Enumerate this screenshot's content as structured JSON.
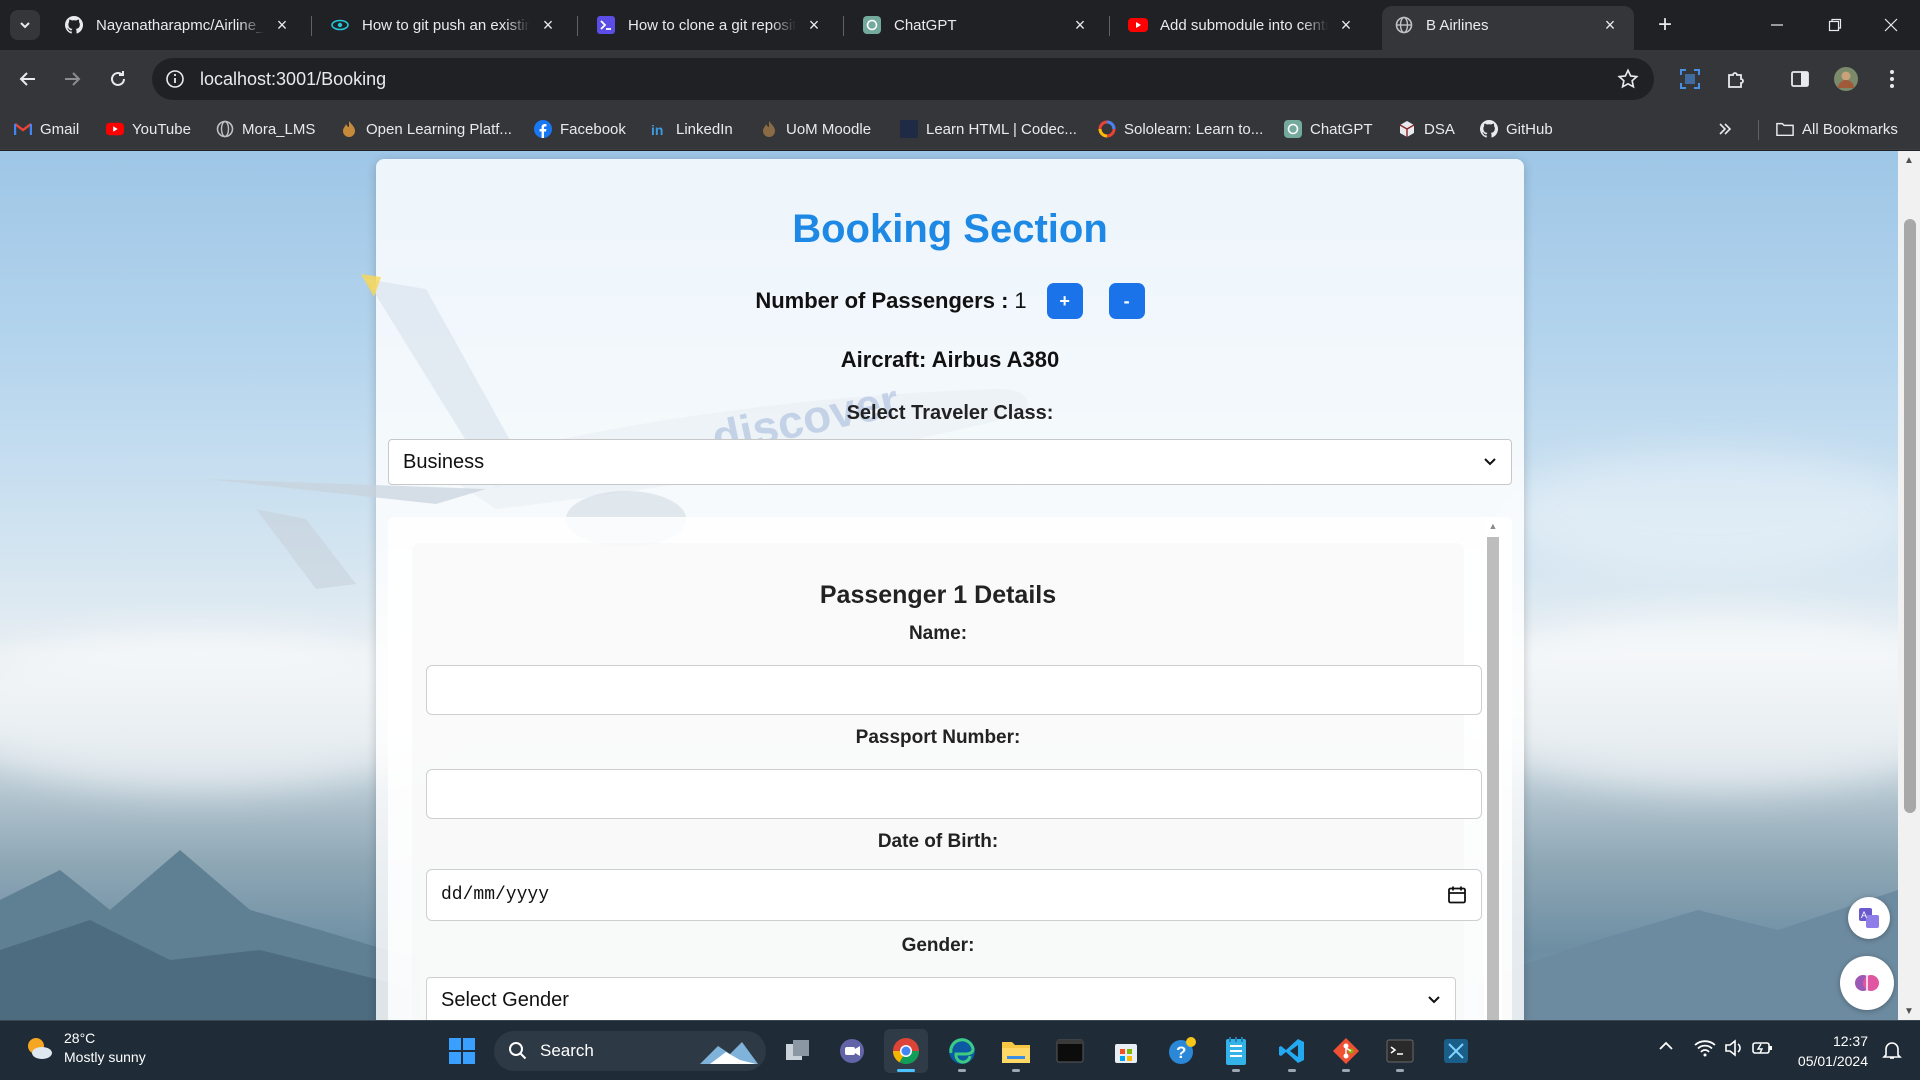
{
  "browser": {
    "tabs": [
      {
        "title": "Nayanatharapmc/Airline_R",
        "favicon": "github-icon"
      },
      {
        "title": "How to git push an existing",
        "favicon": "eye-icon"
      },
      {
        "title": "How to clone a git reposito",
        "favicon": "terminal-icon"
      },
      {
        "title": "ChatGPT",
        "favicon": "chatgpt-icon"
      },
      {
        "title": "Add submodule into centr",
        "favicon": "youtube-icon"
      },
      {
        "title": "B Airlines",
        "favicon": "globe-icon",
        "active": true
      }
    ],
    "url": "localhost:3001/Booking",
    "bookmarks": [
      {
        "label": "Gmail",
        "icon": "gmail-icon"
      },
      {
        "label": "YouTube",
        "icon": "youtube-icon"
      },
      {
        "label": "Mora_LMS",
        "icon": "globe-icon"
      },
      {
        "label": "Open Learning Platf...",
        "icon": "flame-icon"
      },
      {
        "label": "Facebook",
        "icon": "facebook-icon"
      },
      {
        "label": "LinkedIn",
        "icon": "linkedin-icon"
      },
      {
        "label": "UoM Moodle",
        "icon": "flame-icon"
      },
      {
        "label": "Learn HTML | Codec...",
        "icon": "codecademy-icon"
      },
      {
        "label": "Sololearn: Learn to...",
        "icon": "sololearn-icon"
      },
      {
        "label": "ChatGPT",
        "icon": "chatgpt-icon"
      },
      {
        "label": "DSA",
        "icon": "cube-icon"
      },
      {
        "label": "GitHub",
        "icon": "github-icon"
      }
    ],
    "all_bookmarks": "All Bookmarks"
  },
  "page": {
    "title": "Booking Section",
    "passengers_label": "Number of Passengers :",
    "passengers_count": "1",
    "plus_label": "+",
    "minus_label": "-",
    "aircraft": "Aircraft: Airbus A380",
    "class_label": "Select Traveler Class:",
    "class_value": "Business",
    "passenger": {
      "heading": "Passenger 1 Details",
      "name_label": "Name:",
      "name_value": "",
      "passport_label": "Passport Number:",
      "passport_value": "",
      "dob_label": "Date of Birth:",
      "dob_placeholder": "dd/mm/yyyy",
      "gender_label": "Gender:",
      "gender_value": "Select Gender"
    }
  },
  "taskbar": {
    "weather_temp": "28°C",
    "weather_desc": "Mostly sunny",
    "search_label": "Search",
    "time": "12:37",
    "date": "05/01/2024"
  },
  "colors": {
    "accent": "#1e88e5",
    "button": "#1a73e8"
  }
}
